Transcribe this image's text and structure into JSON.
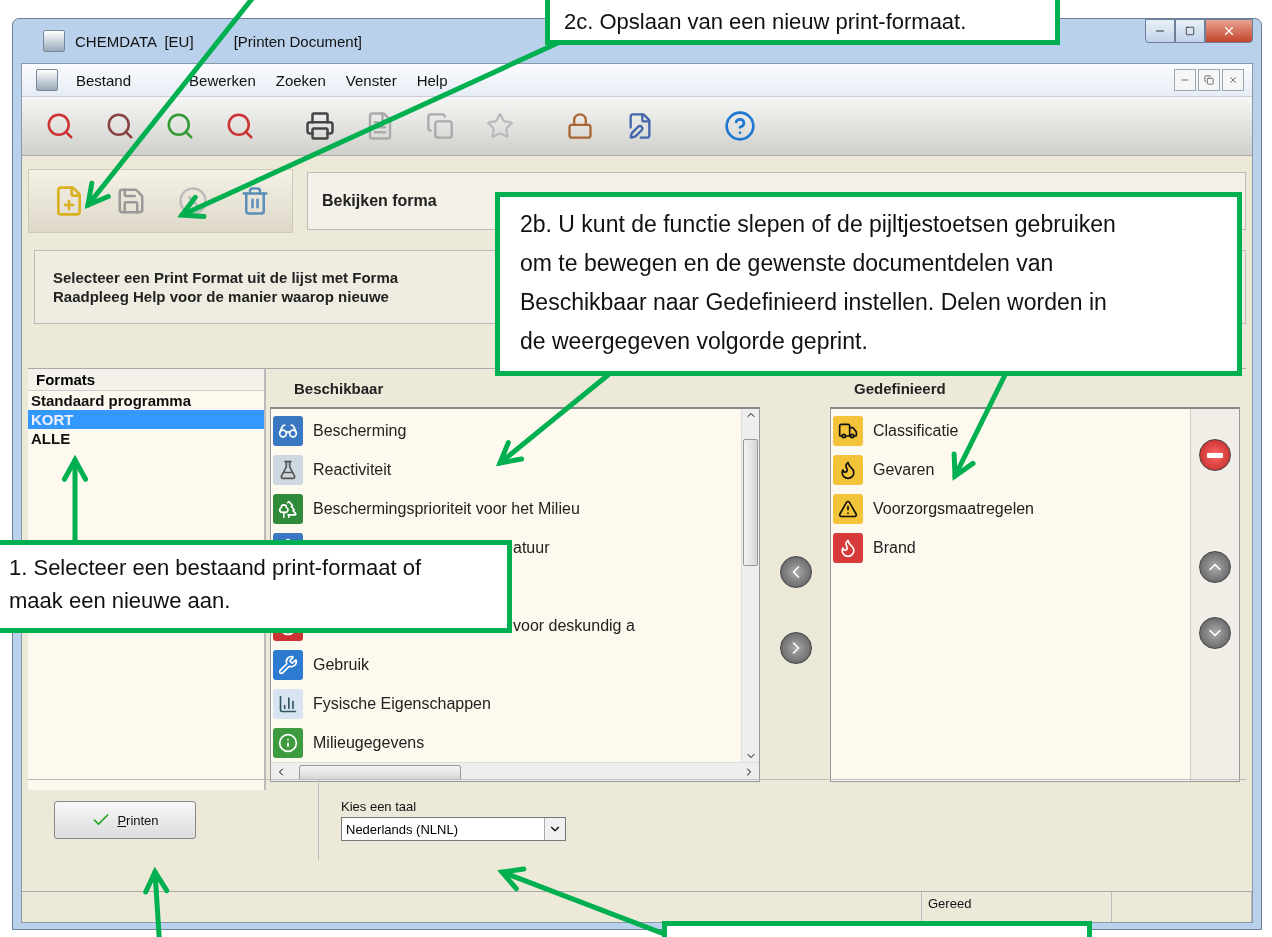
{
  "window": {
    "title_parts": [
      "CHEMDATA  [EU]",
      "[Printen Document]"
    ]
  },
  "menu": [
    {
      "label": "Bestand"
    },
    {
      "label": "Bewerken"
    },
    {
      "label": "Zoeken"
    },
    {
      "label": "Venster"
    },
    {
      "label": "Help"
    }
  ],
  "format_panel": {
    "title": "Bekijken forma"
  },
  "instructions": [
    "Selecteer een Print Format uit de lijst met Forma",
    "Raadpleeg Help voor de manier waarop nieuwe"
  ],
  "formats": {
    "heading": "Formats",
    "items": [
      {
        "label": "Standaard programma",
        "selected": false
      },
      {
        "label": "KORT",
        "selected": true
      },
      {
        "label": "ALLE",
        "selected": false
      }
    ]
  },
  "available": {
    "heading": "Beschikbaar",
    "items": [
      {
        "kind": "full",
        "label": "Bescherming"
      },
      {
        "kind": "full",
        "label": "Reactiviteit"
      },
      {
        "kind": "full",
        "label": "Beschermingsprioriteit voor het Milieu"
      },
      {
        "kind": "partial",
        "label": "atuur"
      },
      {
        "kind": "hidden"
      },
      {
        "kind": "partial",
        "label": "voor deskundig a"
      },
      {
        "kind": "full",
        "label": "Gebruik"
      },
      {
        "kind": "full",
        "label": "Fysische Eigenschappen"
      },
      {
        "kind": "full",
        "label": "Milieugegevens"
      }
    ]
  },
  "defined": {
    "heading": "Gedefinieerd",
    "items": [
      {
        "label": "Classificatie"
      },
      {
        "label": "Gevaren"
      },
      {
        "label": "Voorzorgsmaatregelen"
      },
      {
        "label": "Brand"
      }
    ]
  },
  "language": {
    "label": "Kies een taal",
    "value": "Nederlands (NLNL)"
  },
  "print_button": {
    "label": "Printen"
  },
  "status_bar": {
    "text": "Gereed"
  },
  "callouts": [
    {
      "text": "2c. Opslaan van een nieuw print-formaat."
    },
    {
      "text": "2b. U kunt de functie slepen of de pijltjestoetsen gebruiken om te bewegen en de gewenste documentdelen van Beschikbaar naar Gedefinieerd instellen. Delen worden in de weergegeven volgorde geprint."
    },
    {
      "text": "1. Selecteer een bestaand print-formaat of maak een nieuwe aan."
    }
  ]
}
